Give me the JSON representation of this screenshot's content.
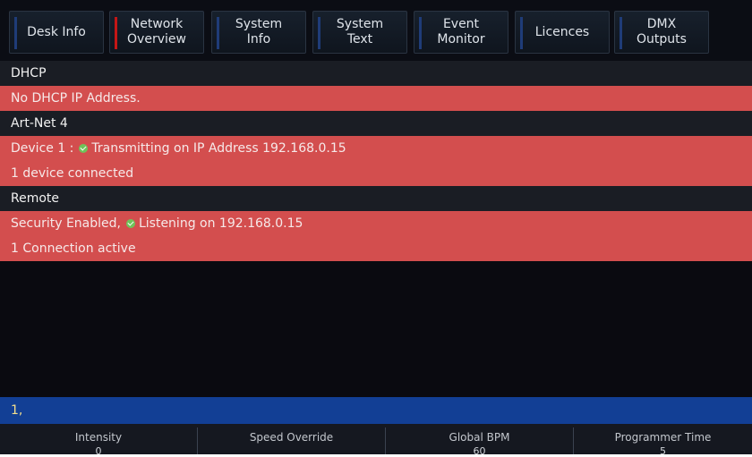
{
  "tabs": [
    {
      "label": "Desk Info",
      "active": false
    },
    {
      "label": "Network\nOverview",
      "active": true
    },
    {
      "label": "System\nInfo",
      "active": false
    },
    {
      "label": "System\nText",
      "active": false
    },
    {
      "label": "Event\nMonitor",
      "active": false
    },
    {
      "label": "Licences",
      "active": false
    },
    {
      "label": "DMX\nOutputs",
      "active": false
    }
  ],
  "sections": {
    "dhcp": {
      "title": "DHCP",
      "status": "No DHCP IP Address."
    },
    "artnet": {
      "title": "Art-Net 4",
      "device_prefix": "Device 1 :",
      "device_status": "Transmitting on IP Address 192.168.0.15",
      "connected": "1 device connected"
    },
    "remote": {
      "title": "Remote",
      "security_prefix": "Security Enabled,",
      "listening": "Listening on 192.168.0.15",
      "connections": "1 Connection active"
    }
  },
  "command_line": "1,",
  "faders": [
    {
      "name": "Intensity",
      "value": "0"
    },
    {
      "name": "Speed Override",
      "value": ""
    },
    {
      "name": "Global BPM",
      "value": "60"
    },
    {
      "name": "Programmer Time",
      "value": "5"
    }
  ],
  "colors": {
    "alert_row": "#d34e4e",
    "header_row": "#1a1d24",
    "command_bar": "#123f95",
    "active_marker": "#c41616",
    "check": "#6fc35a"
  },
  "icons": {
    "status_ok": "check-circle-icon"
  }
}
